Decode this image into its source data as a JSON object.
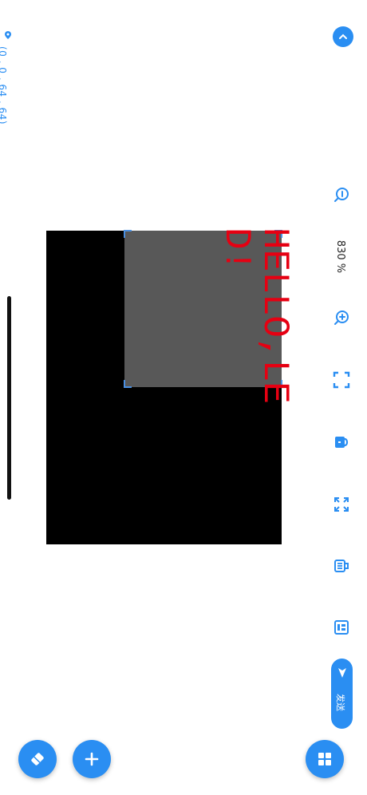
{
  "coordinate": {
    "text": "(0 , 0 , 64 , 64)"
  },
  "canvas": {
    "text": "HELLO,LE\nD!"
  },
  "toolbar": {
    "zoom_label": "830 %",
    "send_label": "发送"
  },
  "icons": {
    "collapse": "chevron-up-icon",
    "info": "info-icon",
    "zoom_in": "zoom-in-icon",
    "fit": "fit-screen-icon",
    "lock": "lock-icon",
    "expand": "expand-icon",
    "list": "list-icon",
    "calendar": "calendar-icon",
    "send": "send-icon",
    "eraser": "eraser-icon",
    "add": "plus-icon",
    "grid": "grid-icon"
  },
  "colors": {
    "accent": "#2a8ef2",
    "canvas_bg": "#000000",
    "overlay": "#585858",
    "text_red": "#e60012"
  }
}
